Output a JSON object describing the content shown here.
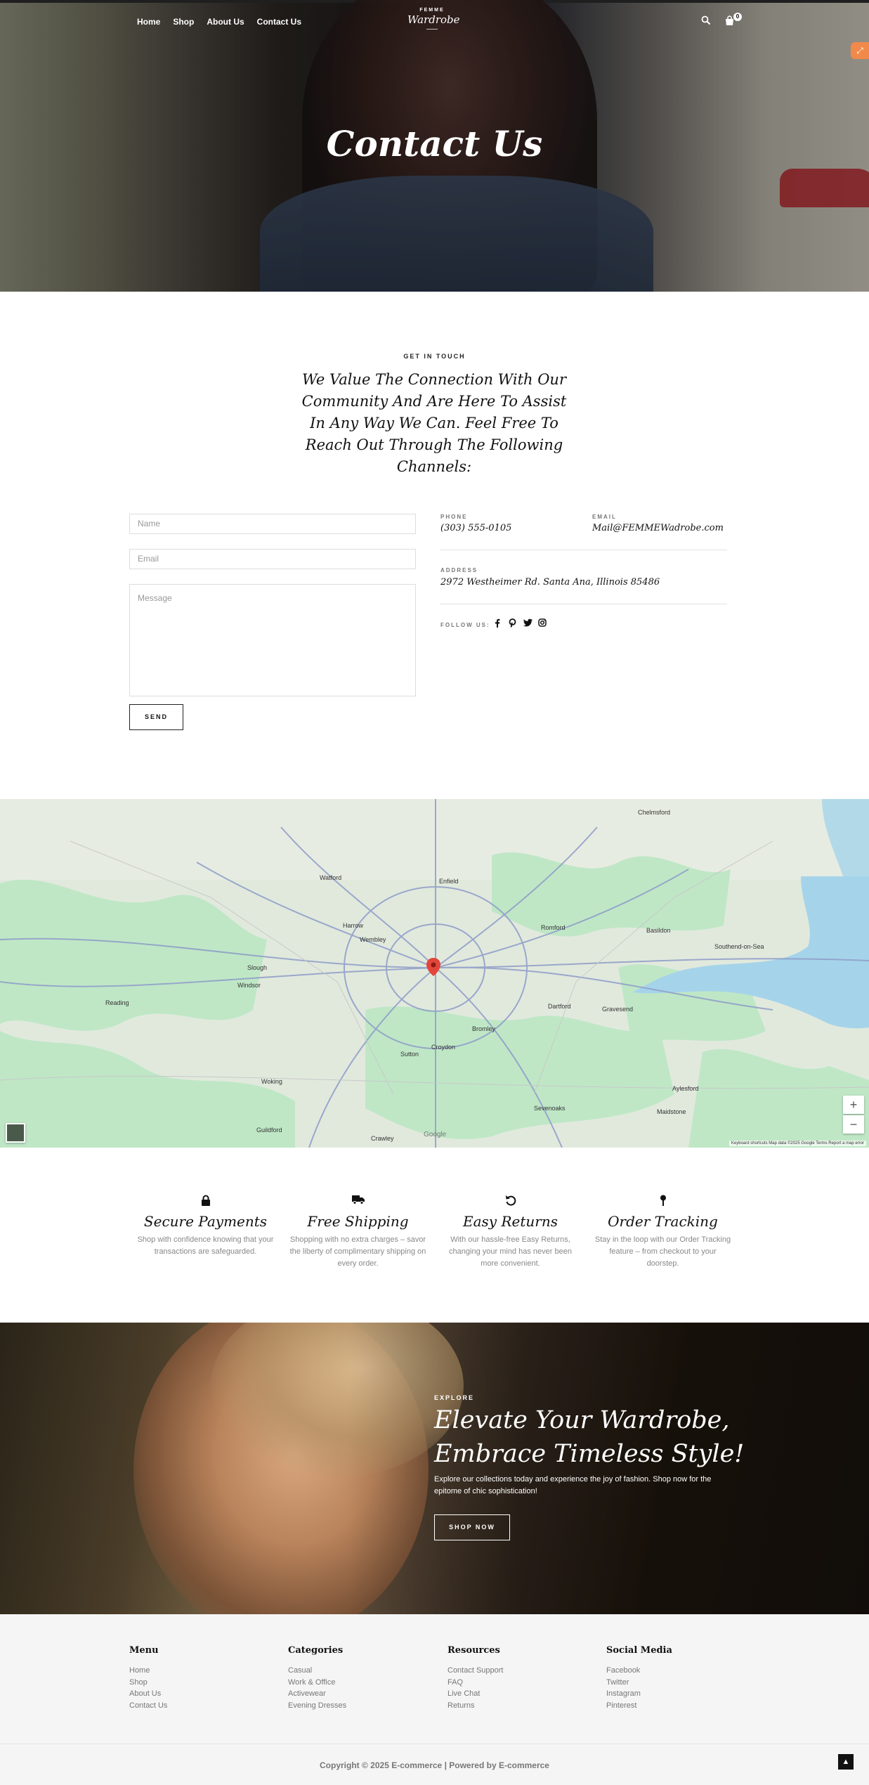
{
  "header": {
    "nav": [
      "Home",
      "Shop",
      "About Us",
      "Contact Us"
    ],
    "logo_small": "FEMME",
    "logo_big": "Wardrobe",
    "cart_count": "0",
    "search_icon": "search-icon",
    "cart_icon": "cart-icon"
  },
  "hero": {
    "title": "Contact Us"
  },
  "contact": {
    "kicker": "GET IN TOUCH",
    "intro": "We Value The Connection With Our Community And Are Here To Assist In Any Way We Can. Feel Free To Reach Out Through The Following Channels:",
    "form": {
      "name_placeholder": "Name",
      "email_placeholder": "Email",
      "message_placeholder": "Message",
      "send_label": "SEND"
    },
    "phone_label": "PHONE",
    "phone": "(303) 555-0105",
    "email_label": "EMAIL",
    "email": "Mail@FEMMEWadrobe.com",
    "address_label": "ADDRESS",
    "address": "2972 Westheimer Rd. Santa Ana, Illinois 85486",
    "follow_label": "FOLLOW US:",
    "social_icons": [
      "facebook-icon",
      "pinterest-icon",
      "twitter-icon",
      "instagram-icon"
    ]
  },
  "map": {
    "attribution": "Keyboard shortcuts   Map data ©2025 Google   Terms   Report a map error",
    "google_label": "Google",
    "places": [
      "Watford",
      "Enfield",
      "Harrow",
      "Wembley",
      "Slough",
      "Reading",
      "Romford",
      "Basildon",
      "Southend-on-Sea",
      "Dartford",
      "Gravesend",
      "Sevenoaks",
      "Guildford",
      "Woking",
      "Croydon",
      "Sutton",
      "Bromley",
      "Maidstone",
      "Chelmsford",
      "Windsor",
      "Crawley",
      "Aylesford"
    ],
    "colors": {
      "water": "#a5d4ea",
      "park": "#bfe7c6",
      "land": "#e3ebdf",
      "road": "#8e9cc8",
      "pin": "#e2463b"
    }
  },
  "features": [
    {
      "icon": "lock-icon",
      "title": "Secure Payments",
      "text": "Shop with confidence knowing that your transactions are safeguarded."
    },
    {
      "icon": "truck-icon",
      "title": "Free Shipping",
      "text": "Shopping with no extra charges – savor the liberty of complimentary shipping on every order."
    },
    {
      "icon": "return-icon",
      "title": "Easy Returns",
      "text": "With our hassle-free Easy Returns, changing your mind has never been more convenient."
    },
    {
      "icon": "pin-icon",
      "title": "Order Tracking",
      "text": "Stay in the loop with our Order Tracking feature – from checkout to your doorstep."
    }
  ],
  "promo": {
    "kicker": "EXPLORE",
    "title": "Elevate Your Wardrobe, Embrace Timeless Style!",
    "text": "Explore our collections today and experience the joy of fashion. Shop now for the epitome of chic sophistication!",
    "button": "SHOP NOW"
  },
  "footer": {
    "columns": [
      {
        "title": "Menu",
        "links": [
          "Home",
          "Shop",
          "About Us",
          "Contact Us"
        ]
      },
      {
        "title": "Categories",
        "links": [
          "Casual",
          "Work & Office",
          "Activewear",
          "Evening Dresses"
        ]
      },
      {
        "title": "Resources",
        "links": [
          "Contact Support",
          "FAQ",
          "Live Chat",
          "Returns"
        ]
      },
      {
        "title": "Social Media",
        "links": [
          "Facebook",
          "Twitter",
          "Instagram",
          "Pinterest"
        ]
      }
    ],
    "copyright": "Copyright © 2025 E-commerce | Powered by E-commerce"
  }
}
